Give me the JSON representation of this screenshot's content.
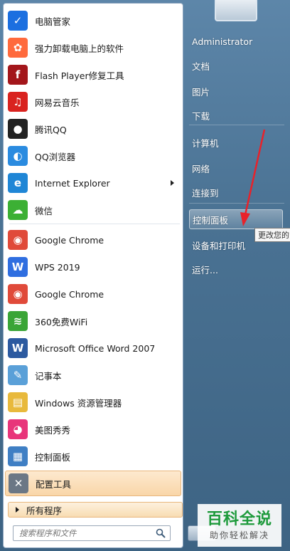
{
  "left_items": [
    {
      "label": "电脑管家",
      "icon": "tencent-pc-manager-icon",
      "color": "#1b6fe0",
      "glyph": "✓"
    },
    {
      "label": "强力卸载电脑上的软件",
      "icon": "uninstaller-icon",
      "color": "#ff6a3d",
      "glyph": "✿"
    },
    {
      "label": "Flash Player修复工具",
      "icon": "flash-player-icon",
      "color": "#a3161b",
      "glyph": "f"
    },
    {
      "label": "网易云音乐",
      "icon": "netease-music-icon",
      "color": "#d9231f",
      "glyph": "♫"
    },
    {
      "label": "腾讯QQ",
      "icon": "qq-penguin-icon",
      "color": "#222222",
      "glyph": "●"
    },
    {
      "label": "QQ浏览器",
      "icon": "qq-browser-icon",
      "color": "#2a8be0",
      "glyph": "◐"
    },
    {
      "label": "Internet Explorer",
      "icon": "internet-explorer-icon",
      "color": "#1f86d6",
      "glyph": "e"
    },
    {
      "label": "微信",
      "icon": "wechat-icon",
      "color": "#3cb034",
      "glyph": "☁"
    },
    {
      "label": "Google Chrome",
      "icon": "chrome-icon",
      "color": "#e04a3a",
      "glyph": "◉"
    },
    {
      "label": "WPS 2019",
      "icon": "wps-icon",
      "color": "#2f6ee0",
      "glyph": "W"
    },
    {
      "label": "Google Chrome",
      "icon": "chrome-icon",
      "color": "#e04a3a",
      "glyph": "◉"
    },
    {
      "label": "360免费WiFi",
      "icon": "wifi-360-icon",
      "color": "#3aa536",
      "glyph": "≋"
    },
    {
      "label": "Microsoft Office Word 2007",
      "icon": "word-icon",
      "color": "#2c5aa0",
      "glyph": "W"
    },
    {
      "label": "记事本",
      "icon": "notepad-icon",
      "color": "#5aa0d8",
      "glyph": "✎"
    },
    {
      "label": "Windows 资源管理器",
      "icon": "explorer-folder-icon",
      "color": "#e8b93c",
      "glyph": "▤"
    },
    {
      "label": "美图秀秀",
      "icon": "meitu-icon",
      "color": "#e8357a",
      "glyph": "◕"
    },
    {
      "label": "控制面板",
      "icon": "control-panel-icon",
      "color": "#3f7fc4",
      "glyph": "▦"
    },
    {
      "label": "配置工具",
      "icon": "config-tools-icon",
      "color": "#6b7785",
      "glyph": "✕"
    }
  ],
  "all_programs_label": "所有程序",
  "search_placeholder": "搜索程序和文件",
  "right_items": [
    {
      "label": "Administrator"
    },
    {
      "label": "文档"
    },
    {
      "label": "图片"
    },
    {
      "label": "下载"
    },
    {
      "label": "计算机"
    },
    {
      "label": "网络"
    },
    {
      "label": "连接到"
    },
    {
      "label": "控制面板"
    },
    {
      "label": "设备和打印机"
    },
    {
      "label": "运行..."
    }
  ],
  "tooltip": "更改您的",
  "watermark": {
    "big": "百科全说",
    "small": "助你轻松解决"
  }
}
